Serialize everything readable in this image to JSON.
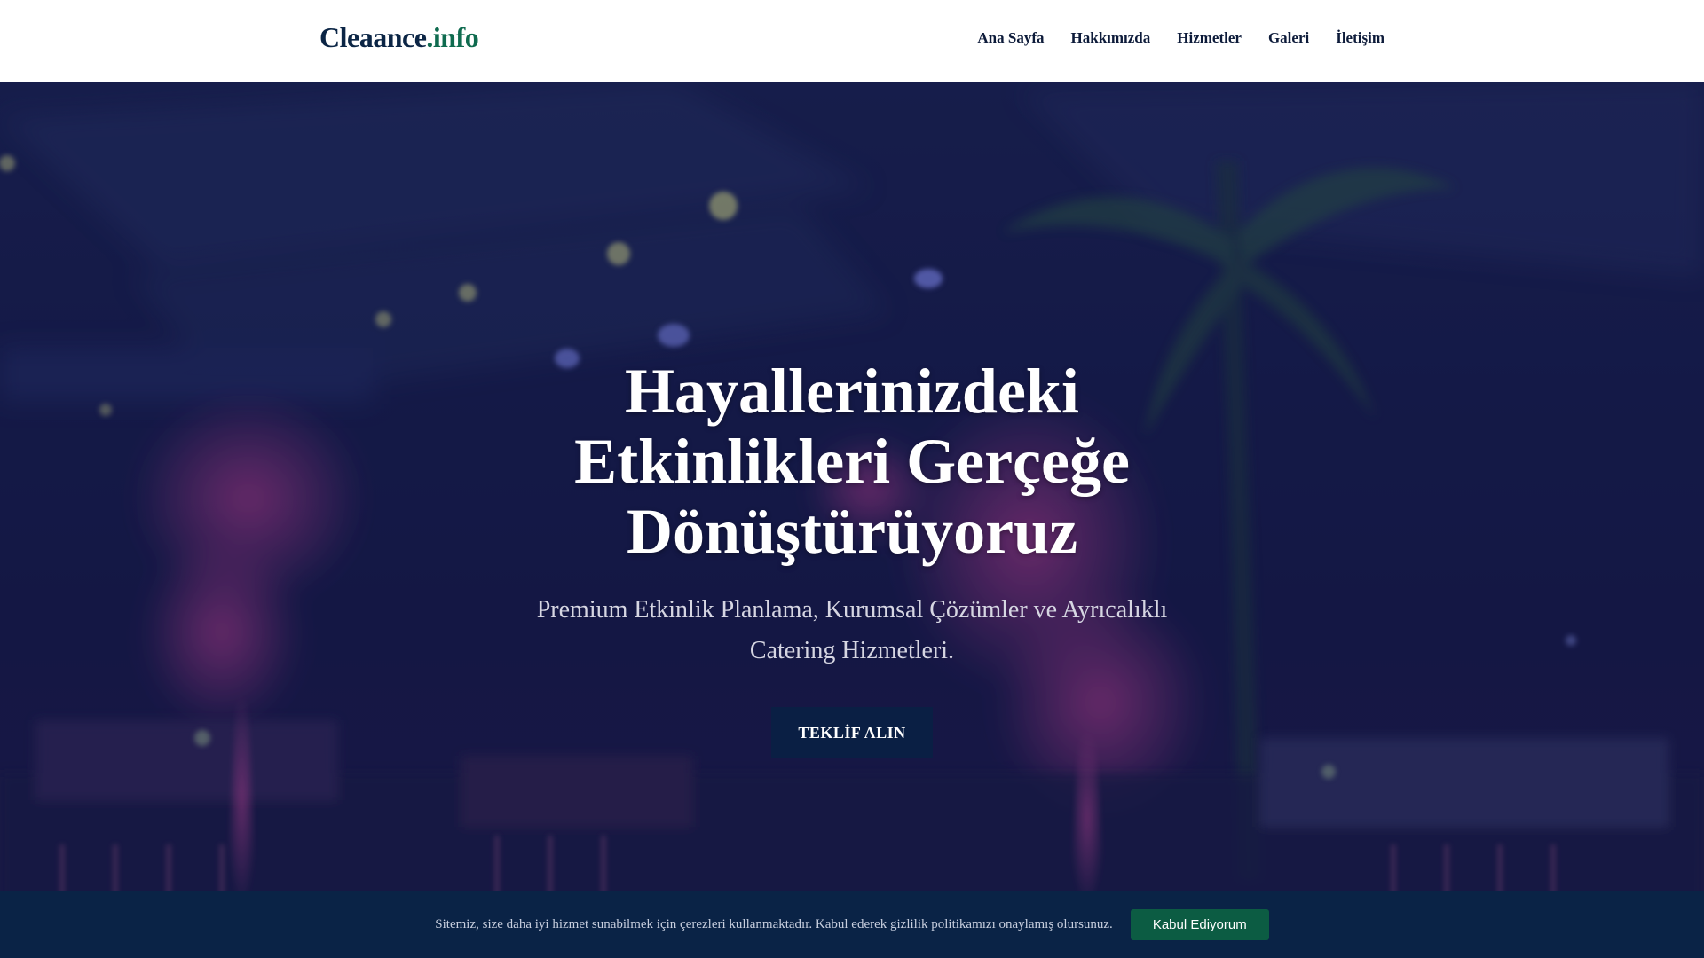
{
  "header": {
    "logo_main": "Cleaance",
    "logo_accent": ".info",
    "nav": [
      {
        "label": "Ana Sayfa"
      },
      {
        "label": "Hakkımızda"
      },
      {
        "label": "Hizmetler"
      },
      {
        "label": "Galeri"
      },
      {
        "label": "İletişim"
      }
    ]
  },
  "hero": {
    "title": "Hayallerinizdeki Etkinlikleri Gerçeğe Dönüştürüyoruz",
    "subtitle": "Premium Etkinlik Planlama, Kurumsal Çözümler ve Ayrıcalıklı Catering Hizmetleri.",
    "cta_label": "TEKLİF ALIN"
  },
  "cookie": {
    "text": "Sitemiz, size daha iyi hizmet sunabilmek için çerezleri kullanmaktadır. Kabul ederek gizlilik politikamızı onaylamış olursunuz.",
    "accept_label": "Kabul Ediyorum"
  },
  "colors": {
    "brand_dark": "#0b2545",
    "brand_accent": "#0f6b4f",
    "cta_background": "#0a1f44",
    "cookie_bar": "#0a2346",
    "cookie_button": "#0c5c43"
  }
}
